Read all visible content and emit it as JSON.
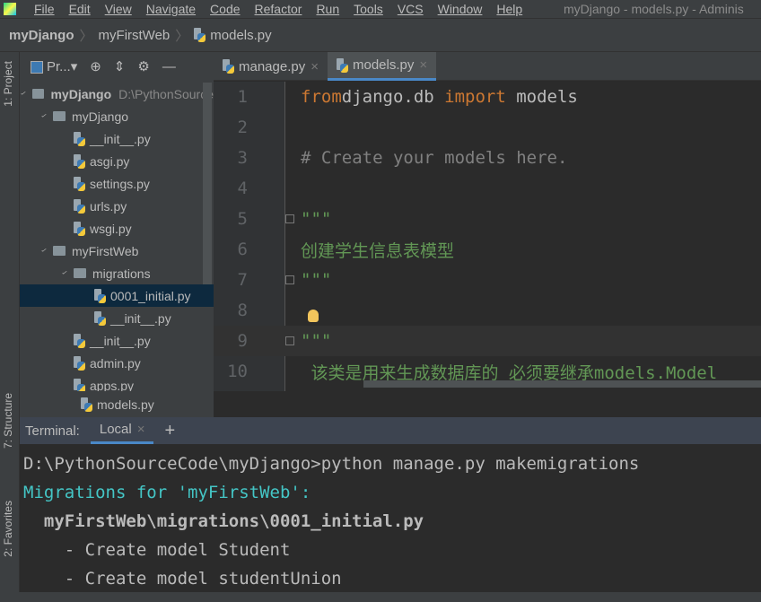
{
  "menu": {
    "items": [
      "File",
      "Edit",
      "View",
      "Navigate",
      "Code",
      "Refactor",
      "Run",
      "Tools",
      "VCS",
      "Window",
      "Help"
    ],
    "window_title": "myDjango - models.py - Adminis"
  },
  "breadcrumb": [
    "myDjango",
    "myFirstWeb",
    "models.py"
  ],
  "side_tabs": {
    "project": "1: Project",
    "structure": "7: Structure",
    "favorites": "2: Favorites"
  },
  "project_panel": {
    "title": "Pr...",
    "tree": [
      {
        "label": "myDjango",
        "path": "D:\\PythonSource",
        "type": "root",
        "level": 0,
        "expanded": true
      },
      {
        "label": "myDjango",
        "type": "folder",
        "level": 1,
        "expanded": true
      },
      {
        "label": "__init__.py",
        "type": "py",
        "level": 2
      },
      {
        "label": "asgi.py",
        "type": "py",
        "level": 2
      },
      {
        "label": "settings.py",
        "type": "py",
        "level": 2
      },
      {
        "label": "urls.py",
        "type": "py",
        "level": 2
      },
      {
        "label": "wsgi.py",
        "type": "py",
        "level": 2
      },
      {
        "label": "myFirstWeb",
        "type": "folder",
        "level": 1,
        "expanded": true
      },
      {
        "label": "migrations",
        "type": "folder",
        "level": 2,
        "expanded": true
      },
      {
        "label": "0001_initial.py",
        "type": "py",
        "level": 3,
        "selected": true
      },
      {
        "label": "__init__.py",
        "type": "py",
        "level": 3
      },
      {
        "label": "__init__.py",
        "type": "py",
        "level": 2
      },
      {
        "label": "admin.py",
        "type": "py",
        "level": 2
      },
      {
        "label": "apps.py",
        "type": "py",
        "level": 2
      },
      {
        "label": "models.py",
        "type": "py",
        "level": 2
      }
    ],
    "open_file": "models.py"
  },
  "editor": {
    "tabs": [
      {
        "label": "manage.py",
        "active": false
      },
      {
        "label": "models.py",
        "active": true
      }
    ],
    "current_line": 9,
    "lines": [
      {
        "n": "1",
        "parts": [
          [
            "kw",
            "from"
          ],
          [
            "",
            "django.db "
          ],
          [
            "kw",
            "import"
          ],
          [
            "",
            " models"
          ]
        ]
      },
      {
        "n": "2",
        "parts": []
      },
      {
        "n": "3",
        "parts": [
          [
            "cm",
            "# Create your models here."
          ]
        ]
      },
      {
        "n": "4",
        "parts": []
      },
      {
        "n": "5",
        "parts": [
          [
            "doc",
            "\"\"\""
          ]
        ]
      },
      {
        "n": "6",
        "parts": [
          [
            "doc",
            "创建学生信息表模型"
          ]
        ]
      },
      {
        "n": "7",
        "parts": [
          [
            "doc",
            "\"\"\""
          ]
        ]
      },
      {
        "n": "8",
        "parts": []
      },
      {
        "n": "9",
        "parts": [
          [
            "doc",
            "\"\"\""
          ]
        ]
      },
      {
        "n": "10",
        "parts": [
          [
            "doc",
            " 该类是用来生成数据库的 必须要继承models.Model"
          ]
        ]
      }
    ]
  },
  "terminal": {
    "label": "Terminal:",
    "tab": "Local",
    "add": "+",
    "lines": [
      {
        "text": "D:\\PythonSourceCode\\myDjango>python manage.py makemigrations",
        "color": "#bbbbbb",
        "bold": false
      },
      {
        "text": "Migrations for 'myFirstWeb':",
        "color": "#44c6c6",
        "bold": false
      },
      {
        "text": "  myFirstWeb\\migrations\\0001_initial.py",
        "color": "#bbbbbb",
        "bold": true
      },
      {
        "text": "    - Create model Student",
        "color": "#bbbbbb",
        "bold": false
      },
      {
        "text": "    - Create model studentUnion",
        "color": "#bbbbbb",
        "bold": false
      }
    ]
  },
  "colors": {
    "accent": "#4a88c7",
    "keyword": "#cc7832",
    "comment": "#808080",
    "docstring": "#629755",
    "terminal_cyan": "#44c6c6"
  }
}
